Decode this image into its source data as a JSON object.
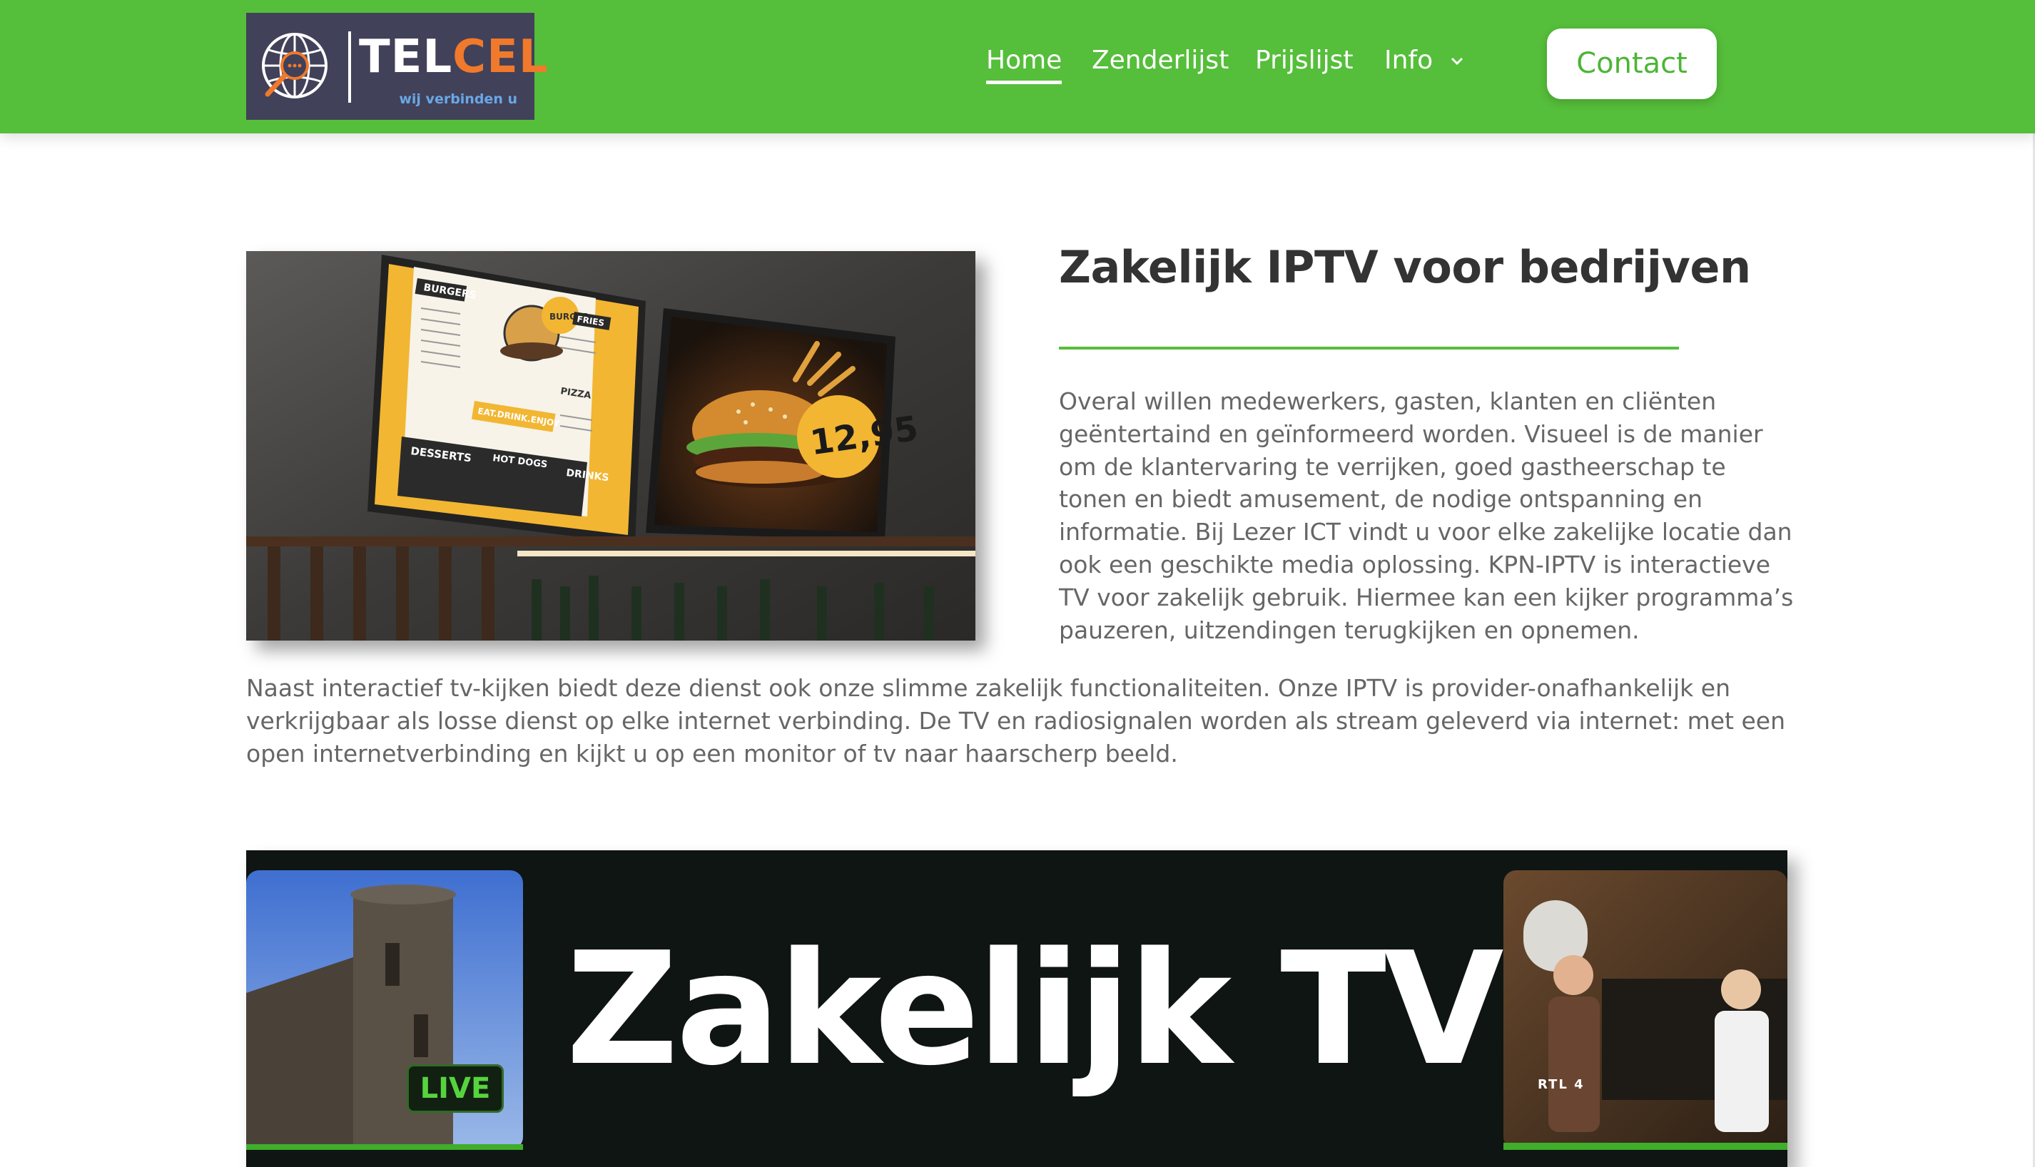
{
  "header": {
    "logo": {
      "brand_part1": "TEL",
      "brand_part2": "CEL",
      "tagline": "wij verbinden u"
    },
    "nav": [
      {
        "label": "Home",
        "active": true
      },
      {
        "label": "Zenderlijst"
      },
      {
        "label": "Prijslijst"
      },
      {
        "label": "Info",
        "has_dropdown": true
      }
    ],
    "contact_label": "Contact"
  },
  "main": {
    "title": "Zakelijk IPTV voor bedrijven",
    "intro": "Overal willen medewerkers, gasten, klanten en cliënten geëntertaind en geïnformeerd worden. Visueel is de manier om de klantervaring te verrijken, goed gastheerschap te tonen en biedt amusement, de nodige ontspanning en informatie. Bij Lezer ICT vindt u voor elke zakelijke locatie dan ook een geschikte media oplossing. KPN-IPTV is interactieve TV voor zakelijk gebruik. Hiermee kan een kijker programma’s pauzeren, uitzendingen terugkijken en opnemen.",
    "body": "Naast interactief tv-kijken biedt deze dienst ook onze slimme zakelijk functionaliteiten. Onze IPTV is provider-onafhankelijk en verkrijgbaar als losse dienst op elke internet verbinding. De TV en radiosignalen worden als stream geleverd via internet: met een open internetverbinding en kijkt u op een monitor of tv naar haarscherp beeld.",
    "menu_image": {
      "menu_labels": [
        "BURGERS",
        "FRIES",
        "PIZZA",
        "DESSERTS",
        "HOT DOGS",
        "DRINKS",
        "EAT.DRINK.ENJOY",
        "BURGER"
      ],
      "price": "12,95"
    },
    "banner": {
      "title": "Zakelijk TV",
      "live_label": "LIVE",
      "channel_label": "RTL 4"
    }
  },
  "colors": {
    "brand_green": "#55be3a",
    "logo_bg": "#414159",
    "accent_orange": "#f0792b",
    "text_gray": "#666666",
    "heading": "#333333"
  }
}
